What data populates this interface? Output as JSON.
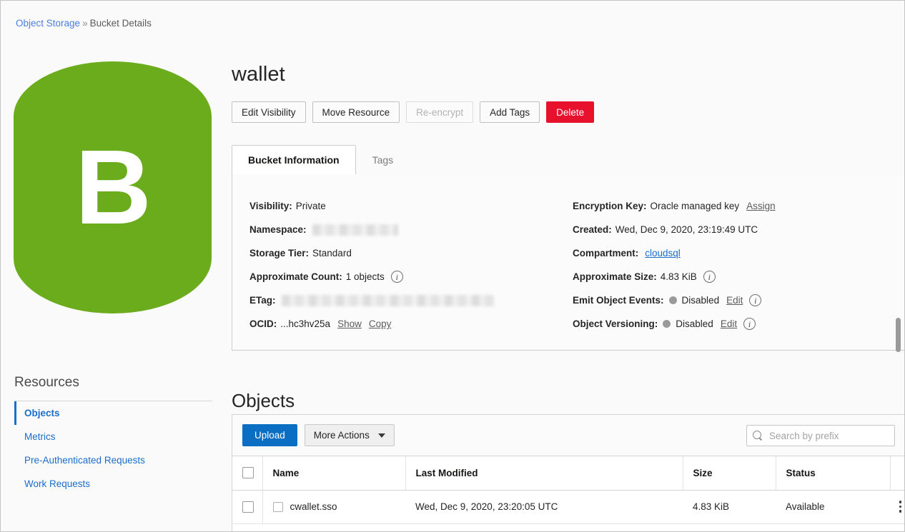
{
  "breadcrumb": {
    "root_label": "Object Storage",
    "separator": "»",
    "current_label": "Bucket Details"
  },
  "bucket_glyph": {
    "letter": "B",
    "color": "#6aac1b"
  },
  "header": {
    "title": "wallet"
  },
  "actions": {
    "edit_visibility": "Edit Visibility",
    "move_resource": "Move Resource",
    "re_encrypt": "Re-encrypt",
    "add_tags": "Add Tags",
    "delete": "Delete",
    "delete_color": "#e8112d"
  },
  "tabs": [
    {
      "label": "Bucket Information",
      "active": true
    },
    {
      "label": "Tags",
      "active": false
    }
  ],
  "bucket_information": {
    "left": {
      "visibility_label": "Visibility:",
      "visibility_value": "Private",
      "namespace_label": "Namespace:",
      "namespace_value": "",
      "storage_tier_label": "Storage Tier:",
      "storage_tier_value": "Standard",
      "approximate_count_label": "Approximate Count:",
      "approximate_count_value": "1 objects",
      "etag_label": "ETag:",
      "etag_value": "",
      "ocid_label": "OCID:",
      "ocid_value": "...hc3hv25a",
      "ocid_show": "Show",
      "ocid_copy": "Copy"
    },
    "right": {
      "encryption_key_label": "Encryption Key:",
      "encryption_key_value": "Oracle managed key",
      "encryption_key_action": "Assign",
      "created_label": "Created:",
      "created_value": "Wed, Dec 9, 2020, 23:19:49 UTC",
      "compartment_label": "Compartment:",
      "compartment_value": "cloudsql",
      "approximate_size_label": "Approximate Size:",
      "approximate_size_value": "4.83 KiB",
      "emit_object_events_label": "Emit Object Events:",
      "emit_object_events_value": "Disabled",
      "emit_object_events_action": "Edit",
      "object_versioning_label": "Object Versioning:",
      "object_versioning_value": "Disabled",
      "object_versioning_action": "Edit",
      "info_icon_glyph": "i"
    }
  },
  "resources": {
    "title": "Resources",
    "items": [
      {
        "label": "Objects",
        "active": true
      },
      {
        "label": "Metrics",
        "active": false
      },
      {
        "label": "Pre-Authenticated Requests",
        "active": false
      },
      {
        "label": "Work Requests",
        "active": false
      }
    ]
  },
  "objects_section": {
    "title": "Objects",
    "toolbar": {
      "upload_label": "Upload",
      "more_actions_label": "More Actions",
      "upload_color": "#0a6ec2"
    },
    "search": {
      "placeholder": "Search by prefix",
      "value": ""
    },
    "table": {
      "columns": [
        "",
        "Name",
        "Last Modified",
        "Size",
        "Status"
      ],
      "rows": [
        {
          "name": "cwallet.sso",
          "last_modified": "Wed, Dec 9, 2020, 23:20:05 UTC",
          "size": "4.83 KiB",
          "status": "Available"
        }
      ]
    }
  }
}
